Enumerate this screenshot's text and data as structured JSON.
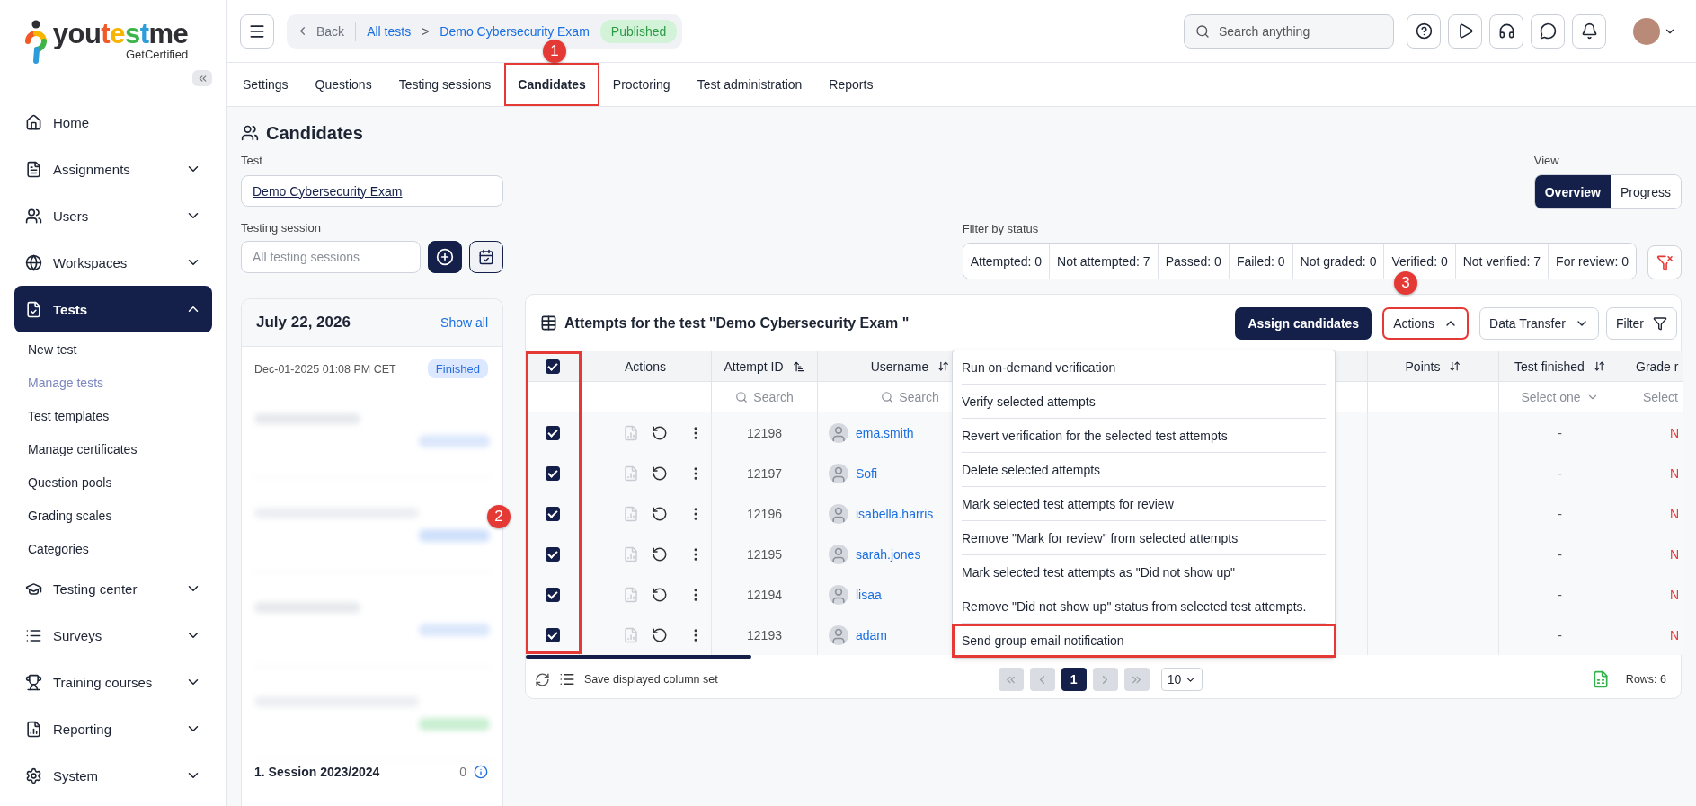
{
  "sidebar": {
    "logo": {
      "wordmark": "youtestme",
      "tagline": "GetCertified"
    },
    "items": [
      {
        "label": "Home",
        "kind": "link",
        "selected": false
      },
      {
        "label": "Assignments",
        "kind": "group",
        "expanded": false,
        "selected": false
      },
      {
        "label": "Users",
        "kind": "group",
        "expanded": false,
        "selected": false
      },
      {
        "label": "Workspaces",
        "kind": "group",
        "expanded": false,
        "selected": false
      },
      {
        "label": "Tests",
        "kind": "group",
        "expanded": true,
        "selected": true,
        "children": [
          {
            "label": "New test",
            "selected": false
          },
          {
            "label": "Manage tests",
            "selected": true
          },
          {
            "label": "Test templates",
            "selected": false
          },
          {
            "label": "Manage certificates",
            "selected": false
          },
          {
            "label": "Question pools",
            "selected": false
          },
          {
            "label": "Grading scales",
            "selected": false
          },
          {
            "label": "Categories",
            "selected": false
          }
        ]
      },
      {
        "label": "Testing center",
        "kind": "group",
        "expanded": false,
        "selected": false
      },
      {
        "label": "Surveys",
        "kind": "group",
        "expanded": false,
        "selected": false
      },
      {
        "label": "Training courses",
        "kind": "group",
        "expanded": false,
        "selected": false
      },
      {
        "label": "Reporting",
        "kind": "group",
        "expanded": false,
        "selected": false
      },
      {
        "label": "System",
        "kind": "group",
        "expanded": false,
        "selected": false
      }
    ]
  },
  "header": {
    "back": "Back",
    "breadcrumb": [
      "All tests",
      "Demo Cybersecurity Exam"
    ],
    "separator": ">",
    "status": "Published",
    "search": {
      "placeholder": "Search anything"
    }
  },
  "tabs": [
    {
      "label": "Settings",
      "selected": false,
      "highlighted": false
    },
    {
      "label": "Questions",
      "selected": false,
      "highlighted": false
    },
    {
      "label": "Testing sessions",
      "selected": false,
      "highlighted": false
    },
    {
      "label": "Candidates",
      "selected": true,
      "highlighted": true
    },
    {
      "label": "Proctoring",
      "selected": false,
      "highlighted": false
    },
    {
      "label": "Test administration",
      "selected": false,
      "highlighted": false
    },
    {
      "label": "Reports",
      "selected": false,
      "highlighted": false
    }
  ],
  "candidates": {
    "title": "Candidates",
    "test_field": {
      "label": "Test",
      "value": "Demo Cybersecurity Exam"
    },
    "session_field": {
      "label": "Testing session",
      "placeholder": "All testing sessions"
    },
    "sessions_panel": {
      "date": "July 22, 2026",
      "show_all": "Show all",
      "first": {
        "time": "Dec-01-2025 01:08 PM CET",
        "status": "Finished"
      },
      "last": {
        "name": "1. Session 2023/2024",
        "count": "0"
      }
    }
  },
  "view": {
    "label": "View",
    "options": [
      {
        "label": "Overview",
        "selected": true
      },
      {
        "label": "Progress",
        "selected": false
      }
    ]
  },
  "status_filter": {
    "label": "Filter by status",
    "chips": [
      "Attempted: 0",
      "Not attempted: 7",
      "Passed: 0",
      "Failed: 0",
      "Not graded: 0",
      "Verified: 0",
      "Not verified: 7",
      "For review: 0"
    ]
  },
  "attempts": {
    "title": "Attempts for the test \"Demo Cybersecurity Exam \"",
    "assign": "Assign candidates",
    "actions": {
      "label": "Actions",
      "expanded": true,
      "highlighted": true
    },
    "data_transfer": "Data Transfer",
    "filter": "Filter",
    "all_checked": true,
    "checkbox_column_highlighted": true,
    "columns": [
      {
        "kind": "actions",
        "label": "Actions"
      },
      {
        "kind": "id",
        "label": "Attempt ID",
        "sortable": true,
        "sorted": true,
        "filter": {
          "kind": "search",
          "placeholder": "Search"
        }
      },
      {
        "kind": "user",
        "label": "Username",
        "sortable": true,
        "sorted": false,
        "filter": {
          "kind": "search",
          "placeholder": "Search"
        }
      },
      {
        "kind": "points",
        "label": "Points",
        "sortable": true,
        "sorted": false
      },
      {
        "kind": "finished",
        "label": "Test finished",
        "sortable": true,
        "sorted": false,
        "filter": {
          "kind": "select",
          "placeholder": "Select one"
        }
      },
      {
        "kind": "grade",
        "label": "Grade r",
        "filter": {
          "kind": "select_cut",
          "placeholder": "Select"
        }
      }
    ],
    "rows": [
      {
        "checked": true,
        "id": "12198",
        "user": "ema.smith",
        "finished": "-",
        "grade": "N"
      },
      {
        "checked": true,
        "id": "12197",
        "user": "Sofi",
        "finished": "-",
        "grade": "N"
      },
      {
        "checked": true,
        "id": "12196",
        "user": "isabella.harris",
        "finished": "-",
        "grade": "N"
      },
      {
        "checked": true,
        "id": "12195",
        "user": "sarah.jones",
        "finished": "-",
        "grade": "N"
      },
      {
        "checked": true,
        "id": "12194",
        "user": "lisaa",
        "finished": "-",
        "grade": "N"
      },
      {
        "checked": true,
        "id": "12193",
        "user": "adam",
        "finished": "-",
        "grade": "N"
      }
    ],
    "menu": [
      {
        "label": "Run on-demand verification",
        "highlighted": false
      },
      {
        "label": "Verify selected attempts",
        "highlighted": false
      },
      {
        "label": "Revert verification for the selected test attempts",
        "highlighted": false
      },
      {
        "label": "Delete selected attempts",
        "highlighted": false
      },
      {
        "label": "Mark selected test attempts for review",
        "highlighted": false
      },
      {
        "label": "Remove \"Mark for review\" from selected attempts",
        "highlighted": false
      },
      {
        "label": "Mark selected test attempts as \"Did not show up\"",
        "highlighted": false
      },
      {
        "label": "Remove \"Did not show up\" status from selected test attempts.",
        "highlighted": false
      },
      {
        "label": "Send group email notification",
        "highlighted": true
      }
    ],
    "footer": {
      "save": "Save displayed column set",
      "pages": [
        {
          "label": "1",
          "selected": true
        }
      ],
      "page_size": "10",
      "rows": "Rows: 6"
    }
  },
  "annotations": [
    {
      "label": "1"
    },
    {
      "label": "2"
    },
    {
      "label": "3"
    }
  ]
}
